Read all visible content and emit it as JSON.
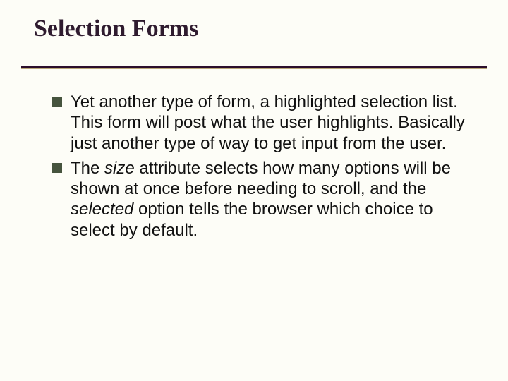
{
  "slide": {
    "title": "Selection Forms",
    "bullets": [
      {
        "pre": "Yet another type of form, a highlighted selection list. This form will post what the user highlights. Basically just another type of way to get input from the user."
      },
      {
        "pre": "The ",
        "em1": "size",
        "mid": " attribute selects how many options will be shown at once before needing to scroll, and the ",
        "em2": "selected",
        "post": " option tells the browser which choice to select by default."
      }
    ]
  }
}
